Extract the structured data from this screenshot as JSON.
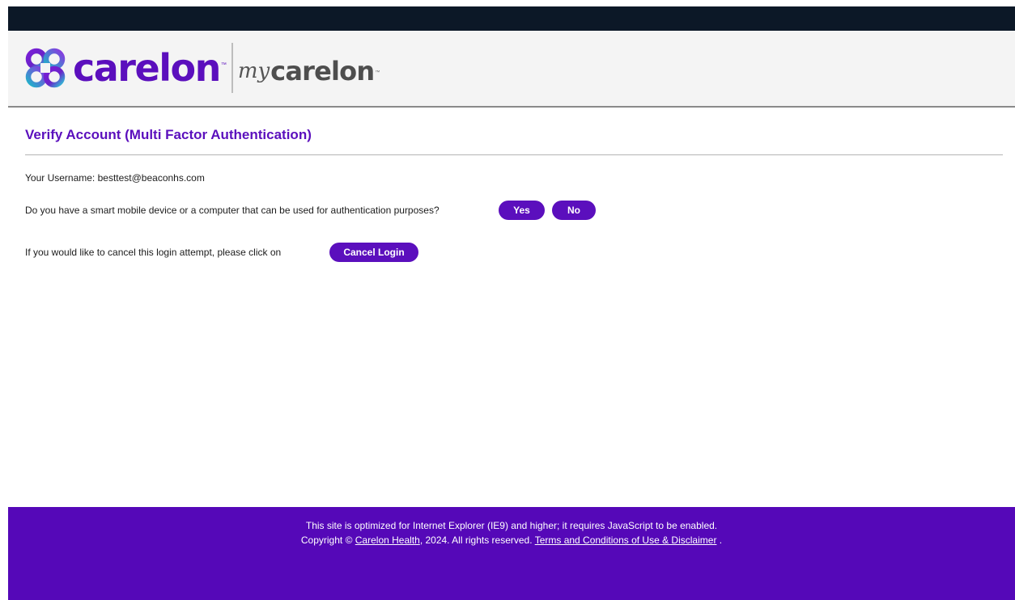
{
  "header": {
    "brand": "carelon",
    "sub_brand_prefix": "my",
    "sub_brand": "carelon",
    "trademark": "™",
    "colors": {
      "brand_purple": "#5b0fbd",
      "top_bar": "#0c1827",
      "footer_purple": "#5508b8"
    },
    "logo_icon": "carelon-knot-logo-icon"
  },
  "page": {
    "title": "Verify Account (Multi Factor Authentication)"
  },
  "username": {
    "text": "Your Username: besttest@beaconhs.com"
  },
  "device_question": {
    "text": "Do you have a smart mobile device or a computer that can be used for authentication purposes?",
    "yes_label": "Yes",
    "no_label": "No"
  },
  "cancel": {
    "text": "If you would like to cancel this login attempt, please click on",
    "button_label": "Cancel Login"
  },
  "footer": {
    "line1": "This site is optimized for Internet Explorer (IE9) and higher; it requires JavaScript to be enabled.",
    "copyright_prefix": "Copyright ©",
    "company_link": "Carelon Health",
    "copyright_suffix": ", 2024. All rights reserved.",
    "terms_link": "Terms and Conditions of Use & Disclaimer",
    "terms_suffix": "."
  }
}
